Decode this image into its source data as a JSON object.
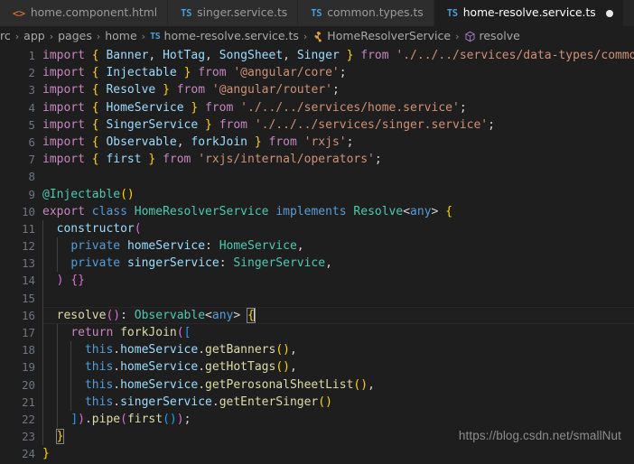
{
  "tabs": [
    {
      "label": "home.component.html",
      "icon": "html-file-icon",
      "icon_glyph": "<>",
      "active": false,
      "dirty": false
    },
    {
      "label": "singer.service.ts",
      "icon": "typescript-file-icon",
      "icon_glyph": "TS",
      "active": false,
      "dirty": false
    },
    {
      "label": "common.types.ts",
      "icon": "typescript-file-icon",
      "icon_glyph": "TS",
      "active": false,
      "dirty": false
    },
    {
      "label": "home-resolve.service.ts",
      "icon": "typescript-file-icon",
      "icon_glyph": "TS",
      "active": true,
      "dirty": true
    }
  ],
  "breadcrumb": {
    "items": [
      {
        "label": "rc",
        "icon": null
      },
      {
        "label": "app",
        "icon": null
      },
      {
        "label": "pages",
        "icon": null
      },
      {
        "label": "home",
        "icon": null
      },
      {
        "label": "home-resolve.service.ts",
        "icon": "typescript-file-icon",
        "icon_glyph": "TS"
      },
      {
        "label": "HomeResolverService",
        "icon": "class-symbol-icon"
      },
      {
        "label": "resolve",
        "icon": "method-symbol-icon"
      }
    ],
    "separator": "›"
  },
  "editor": {
    "language": "typescript",
    "current_line": 16,
    "watermark": "https://blog.csdn.net/smallNut",
    "line_numbers": [
      "1",
      "2",
      "3",
      "4",
      "5",
      "6",
      "7",
      "8",
      "9",
      "10",
      "11",
      "12",
      "13",
      "14",
      "15",
      "16",
      "17",
      "18",
      "19",
      "20",
      "21",
      "22",
      "23",
      "24"
    ],
    "lines": [
      "import { Banner, HotTag, SongSheet, Singer } from './../../services/data-types/common",
      "import { Injectable } from '@angular/core';",
      "import { Resolve } from '@angular/router';",
      "import { HomeService } from './../../services/home.service';",
      "import { SingerService } from './../../services/singer.service';",
      "import { Observable, forkJoin } from 'rxjs';",
      "import { first } from 'rxjs/internal/operators';",
      "",
      "@Injectable()",
      "export class HomeResolverService implements Resolve<any> {",
      "  constructor(",
      "    private homeService: HomeService,",
      "    private singerService: SingerService,",
      "  ) {}",
      "",
      "  resolve(): Observable<any> {",
      "    return forkJoin([",
      "      this.homeService.getBanners(),",
      "      this.homeService.getHotTags(),",
      "      this.homeService.getPerosonalSheetList(),",
      "      this.singerService.getEnterSinger()",
      "    ]).pipe(first());",
      "  }",
      "}"
    ]
  },
  "colors": {
    "editor_background": "#1e1e1e",
    "tabbar_background": "#252526",
    "inactive_tab_background": "#2d2d2d",
    "line_number": "#6e7681",
    "keyword_control": "#c586c0",
    "keyword": "#569cd6",
    "type": "#4ec9b0",
    "variable": "#9cdcfe",
    "string": "#ce9178",
    "function": "#dcdcaa",
    "ts_icon": "#4a9fd4",
    "html_icon": "#e37933",
    "class_icon": "#e3a13c",
    "method_icon": "#b180d7"
  }
}
